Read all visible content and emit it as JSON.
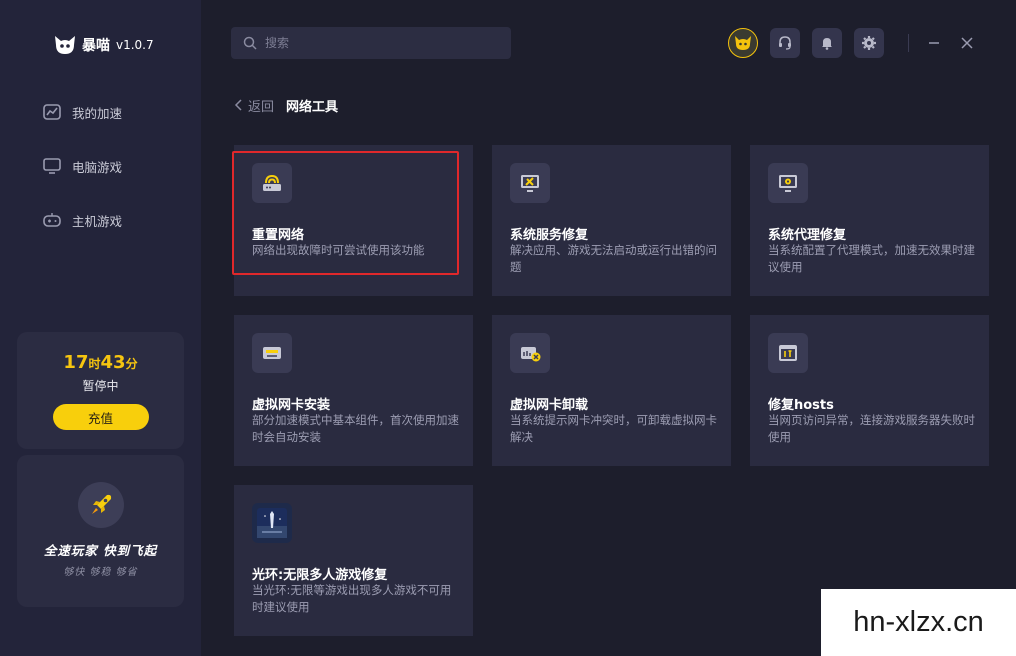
{
  "app": {
    "name": "暴喵",
    "version": "v1.0.7"
  },
  "sidebar": {
    "items": [
      {
        "label": "我的加速",
        "icon": "speed-chart-icon"
      },
      {
        "label": "电脑游戏",
        "icon": "monitor-icon"
      },
      {
        "label": "主机游戏",
        "icon": "gamepad-icon"
      }
    ],
    "time_card": {
      "hours": "17",
      "hours_unit": "时",
      "minutes": "43",
      "minutes_unit": "分",
      "status": "暂停中",
      "recharge_label": "充值"
    },
    "promo": {
      "title": "全速玩家  快到飞起",
      "subtitle": "够快  够稳  够省"
    }
  },
  "header": {
    "search_placeholder": "搜索"
  },
  "breadcrumb": {
    "back_label": "返回",
    "title": "网络工具"
  },
  "tools": [
    {
      "title": "重置网络",
      "desc": "网络出现故障时可尝试使用该功能",
      "icon": "router-icon"
    },
    {
      "title": "系统服务修复",
      "desc": "解决应用、游戏无法启动或运行出错的问题",
      "icon": "monitor-wrench-icon"
    },
    {
      "title": "系统代理修复",
      "desc": "当系统配置了代理模式，加速无效果时建议使用",
      "icon": "monitor-gear-icon"
    },
    {
      "title": "虚拟网卡安装",
      "desc": "部分加速模式中基本组件，首次使用加速时会自动安装",
      "icon": "network-card-icon"
    },
    {
      "title": "虚拟网卡卸载",
      "desc": "当系统提示网卡冲突时，可卸载虚拟网卡解决",
      "icon": "network-card-remove-icon"
    },
    {
      "title": "修复hosts",
      "desc": "当网页访问异常，连接游戏服务器失败时使用",
      "icon": "browser-tools-icon"
    },
    {
      "title": "光环:无限多人游戏修复",
      "desc": "当光环:无限等游戏出现多人游戏不可用时建议使用",
      "icon": "halo-game-icon"
    }
  ],
  "watermark": "hn-xlzx.cn",
  "colors": {
    "accent": "#f8cf0c",
    "highlight": "#e0282b",
    "card_bg": "#2a2b40",
    "app_bg": "#1d1e2c"
  }
}
